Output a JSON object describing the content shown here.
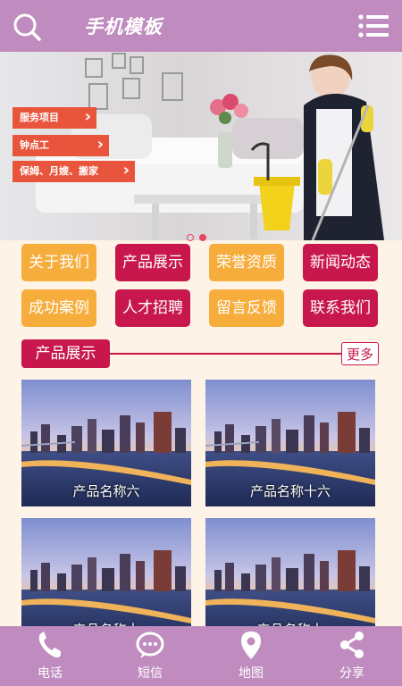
{
  "header": {
    "title": "手机模板"
  },
  "banner": {
    "tags": [
      "服务项目",
      "钟点工",
      "保姆、月嫂、搬家"
    ],
    "slide_count": 2,
    "active_slide": 2
  },
  "nav": {
    "items": [
      "关于我们",
      "产品展示",
      "荣誉资质",
      "新闻动态",
      "成功案例",
      "人才招聘",
      "留言反馈",
      "联系我们"
    ]
  },
  "section": {
    "title": "产品展示",
    "more": "更多"
  },
  "products": [
    "产品名称六",
    "产品名称十六",
    "产品名称十",
    "产品名称十"
  ],
  "footer": {
    "items": [
      "电话",
      "短信",
      "地图",
      "分享"
    ]
  },
  "colors": {
    "header": "#c08cbf",
    "accent": "#c8174c",
    "orange": "#f6ad3c",
    "background": "#fdf3e6"
  }
}
